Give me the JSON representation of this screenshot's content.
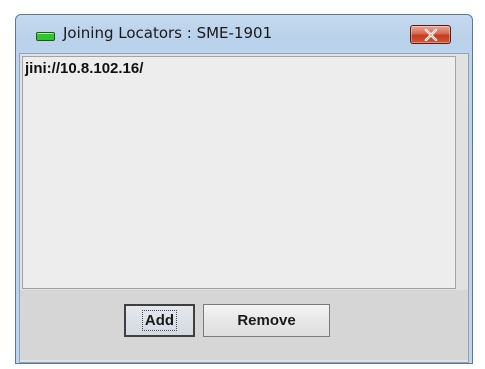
{
  "window": {
    "title": "Joining Locators : SME-1901",
    "icon": "green-led-icon",
    "close_icon": "close-icon"
  },
  "locators": {
    "items": [
      {
        "label": "jini://10.8.102.16/"
      }
    ]
  },
  "buttons": {
    "add_label": "Add",
    "remove_label": "Remove"
  },
  "colors": {
    "close_button": "#c94a30",
    "status_led": "#2fc52f"
  }
}
